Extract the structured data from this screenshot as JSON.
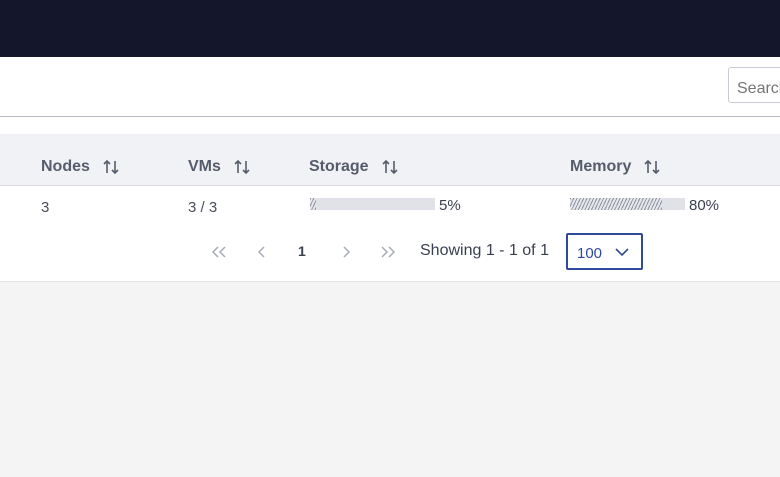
{
  "search": {
    "placeholder": "Search"
  },
  "table": {
    "columns": [
      {
        "label": "Nodes"
      },
      {
        "label": "VMs"
      },
      {
        "label": "Storage"
      },
      {
        "label": "Memory"
      }
    ],
    "rows": [
      {
        "nodes": "3",
        "vms": "3 / 3",
        "storage": {
          "percent": 5,
          "label": "5%"
        },
        "memory": {
          "percent": 80,
          "label": "80%"
        }
      }
    ]
  },
  "pagination": {
    "current_page": "1",
    "showing_text": "Showing 1 - 1 of 1",
    "page_size": "100"
  },
  "icons": {
    "first": "double-chevron-left-icon",
    "prev": "chevron-left-icon",
    "next": "chevron-right-icon",
    "last": "double-chevron-right-icon",
    "sort": "sort-arrows-icon",
    "dropdown": "chevron-down-icon"
  },
  "colors": {
    "topbar": "#14172b",
    "accent": "#2f4a9c",
    "header_bg": "#f1f2f5"
  }
}
